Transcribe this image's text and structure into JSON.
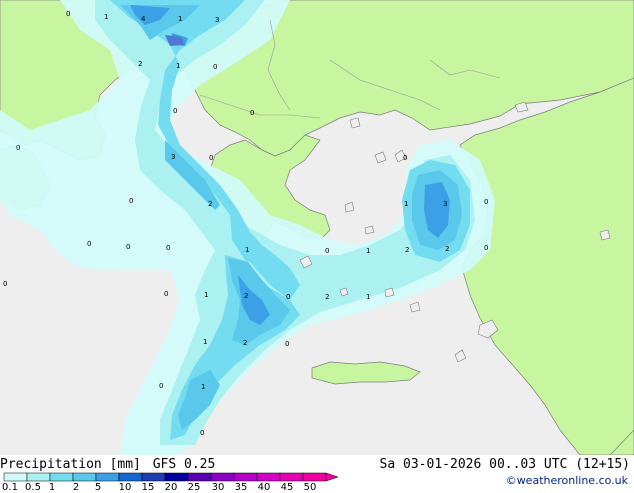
{
  "title": "Precipitation [mm]",
  "model": "GFS 0.25",
  "valid_time": "Sa 03-01-2026 00..03 UTC (12+15)",
  "credit": "©weatheronline.co.uk",
  "colors": {
    "sea": "#eeeeee",
    "land": "#c8f5a0",
    "precip_0_1": "#d2fafa",
    "precip_0_5": "#aaf0f0",
    "precip_1": "#73dcf0",
    "precip_2": "#5ac8eb",
    "precip_5": "#3ca0e6",
    "precip_10": "#5078d2",
    "coast": "#7d7d7d"
  },
  "legend": {
    "ticks": [
      "0.1",
      "0.5",
      "1",
      "2",
      "5",
      "10",
      "15",
      "20",
      "25",
      "30",
      "35",
      "40",
      "45",
      "50"
    ],
    "colors": [
      "#d2fafa",
      "#aaf0f0",
      "#73dcf0",
      "#5ac8eb",
      "#3ca0e6",
      "#1464d2",
      "#1e3cb4",
      "#0000a0",
      "#5a00b4",
      "#8c00c8",
      "#b400c8",
      "#d200c8",
      "#e600b4",
      "#f000a0"
    ]
  },
  "point_values": [
    "0",
    "1",
    "4",
    "1",
    "3",
    "2",
    "1",
    "0",
    "0",
    "0",
    "0",
    "3",
    "0",
    "0",
    "2",
    "0",
    "0",
    "0",
    "0",
    "1",
    "0",
    "1",
    "0",
    "1",
    "2",
    "0",
    "2",
    "1",
    "2",
    "2",
    "0",
    "0",
    "1",
    "2",
    "0",
    "0",
    "1",
    "1",
    "0",
    "3",
    "0"
  ]
}
